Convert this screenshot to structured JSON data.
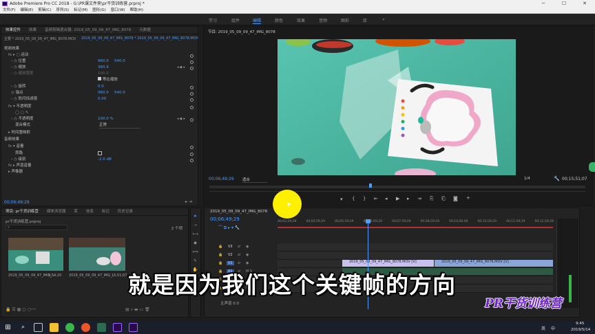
{
  "window": {
    "title": "Adobe Premiere Pro CC 2018 - G:\\PR课文件夹\\pr干货训练营.prproj *"
  },
  "window_controls": {
    "minimize": "─",
    "maximize": "☐",
    "close": "✕"
  },
  "menu": [
    "文件(F)",
    "编辑(E)",
    "剪辑(C)",
    "序列(S)",
    "标记(M)",
    "图形(G)",
    "窗口(W)",
    "帮助(H)"
  ],
  "workspaces": [
    "学习",
    "组件",
    "编辑",
    "颜色",
    "效果",
    "音频",
    "图形",
    "库"
  ],
  "workspace_more": "»",
  "effect_controls": {
    "tabs": [
      "效果控件",
      "效果",
      "音频剪辑混合器: 2019_05_09_09_47_IMG_8078",
      "元数据"
    ],
    "source_label": "主要 * 2019_05_09_09_47_IMG_8078.MOV",
    "sequence_label": "2019_05_09_09_47_IMG_8078 * 2019_05_09_09_47_IMG_8078.MOV",
    "video_effects": "视频效果",
    "motion": "运动",
    "position": {
      "label": "位置",
      "x": "960.0",
      "y": "540.0"
    },
    "scale": {
      "label": "缩放",
      "value": "360.9"
    },
    "scale_width": {
      "label": "缩放宽度",
      "value": "100.0"
    },
    "uniform_scale": "等比缩放",
    "rotation": {
      "label": "旋转",
      "value": "0.0"
    },
    "anchor": {
      "label": "锚点",
      "x": "960.0",
      "y": "540.0"
    },
    "flicker": {
      "label": "防闪烁滤镜",
      "value": "0.00"
    },
    "opacity": "不透明度",
    "opacity_value": {
      "label": "不透明度",
      "value": "100.0 %"
    },
    "blend_mode": {
      "label": "混合模式",
      "value": "正常"
    },
    "time_remap": "时间重映射",
    "audio_effects": "音频效果",
    "volume": "音量",
    "bypass": "旁路",
    "level": {
      "label": "级别",
      "value": "-2.0 dB"
    },
    "channel_volume": "声道音量",
    "panner": "声像器",
    "timecode": "00;06;49;29"
  },
  "program_monitor": {
    "title": "节目: 2019_05_09_09_47_IMG_8078",
    "timecode": "00;06;49;29",
    "fit": "适合",
    "quality": "1/4",
    "duration": "00;15;51;07"
  },
  "project": {
    "tabs": [
      "项目: pr干货训练营",
      "媒体浏览器",
      "库",
      "信息",
      "标记",
      "历史记录"
    ],
    "file": "pr干货训练营.prproj",
    "count": "2 个项",
    "items": [
      {
        "name": "2019_05_09_09_47_IMG_...",
        "duration": "9;54;20"
      },
      {
        "name": "2019_05_09_09_47_IMG_...",
        "duration": "15;51;07"
      }
    ]
  },
  "timeline": {
    "title": "2019_05_09_09_47_IMG_8078",
    "timecode": "00;06;49;29",
    "ruler": [
      "00;03;59;28",
      "00;04;59;29",
      "00;05;59;29",
      "00;06;59;29",
      "00;07;59;29",
      "00;08;59;29",
      "00;10;00;00",
      "00;10;59;29",
      "00;11;59;29",
      "00;12;59;28"
    ],
    "tracks": [
      "V3",
      "V2",
      "V1",
      "A1",
      "A2",
      "A3"
    ],
    "master": {
      "label": "主声道",
      "value": "0.0"
    },
    "clips": [
      {
        "label": "2019_05_09_09_47_IMG_8078.MOV [V]"
      },
      {
        "label": "2019_05_09_09_47_IMG_8078.MOV [V]"
      }
    ]
  },
  "caption": "就是因为我们这个关键帧的方向",
  "watermark": "PR干货训练营",
  "taskbar": {
    "time": "9:45",
    "date": "2019/5/14",
    "tray": [
      "英",
      "中"
    ]
  },
  "colors": {
    "accent": "#4e9cff",
    "playhead": "#4e9cff",
    "clip": "#a9a2d6"
  }
}
